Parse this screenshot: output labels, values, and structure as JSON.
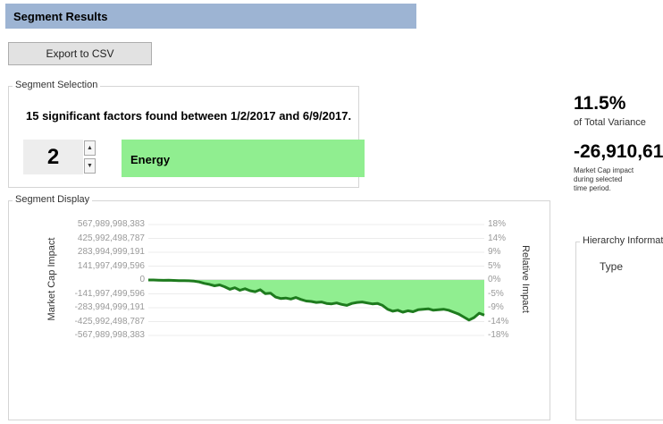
{
  "header": {
    "title": "Segment Results"
  },
  "toolbar": {
    "export_label": "Export to CSV"
  },
  "segment_selection": {
    "group_label": "Segment Selection",
    "summary": "15 significant factors found between 1/2/2017 and 6/9/2017.",
    "index_value": "2",
    "segment_name": "Energy",
    "segment_color": "#90ee90"
  },
  "stats": {
    "variance_value": "11.5%",
    "variance_label": "of Total Variance",
    "impact_value": "-26,910,61",
    "impact_desc_1": "Market Cap impact",
    "impact_desc_2": "during selected",
    "impact_desc_3": "time period."
  },
  "hierarchy": {
    "group_label": "Hierarchy Informat",
    "type_label": "Type"
  },
  "segment_display": {
    "group_label": "Segment Display"
  },
  "chart_data": {
    "type": "area",
    "ylabel": "Market Cap Impact",
    "y2label": "Relative Impact",
    "left_ticks": [
      "567,989,998,383",
      "425,992,498,787",
      "283,994,999,191",
      "141,997,499,596",
      "0",
      "-141,997,499,596",
      "-283,994,999,191",
      "-425,992,498,787",
      "-567,989,998,383"
    ],
    "right_ticks": [
      "18%",
      "14%",
      "9%",
      "5%",
      "0%",
      "-5%",
      "-9%",
      "-14%",
      "-18%"
    ],
    "ylim": [
      -567989998383,
      567989998383
    ],
    "grid": true,
    "line_color": "#1e7b1e",
    "fill_color": "#90ee90",
    "values": [
      0,
      0,
      -2000000000.0,
      -4000000000.0,
      -3000000000.0,
      -5000000000.0,
      -7000000000.0,
      -6000000000.0,
      -8000000000.0,
      -12000000000.0,
      -20000000000.0,
      -35000000000.0,
      -45000000000.0,
      -60000000000.0,
      -50000000000.0,
      -70000000000.0,
      -95000000000.0,
      -80000000000.0,
      -105000000000.0,
      -90000000000.0,
      -110000000000.0,
      -120000000000.0,
      -100000000000.0,
      -140000000000.0,
      -135000000000.0,
      -175000000000.0,
      -190000000000.0,
      -185000000000.0,
      -195000000000.0,
      -180000000000.0,
      -200000000000.0,
      -215000000000.0,
      -220000000000.0,
      -230000000000.0,
      -225000000000.0,
      -240000000000.0,
      -245000000000.0,
      -235000000000.0,
      -250000000000.0,
      -260000000000.0,
      -240000000000.0,
      -230000000000.0,
      -225000000000.0,
      -235000000000.0,
      -245000000000.0,
      -240000000000.0,
      -260000000000.0,
      -300000000000.0,
      -320000000000.0,
      -310000000000.0,
      -330000000000.0,
      -315000000000.0,
      -325000000000.0,
      -305000000000.0,
      -300000000000.0,
      -295000000000.0,
      -310000000000.0,
      -305000000000.0,
      -300000000000.0,
      -310000000000.0,
      -330000000000.0,
      -350000000000.0,
      -380000000000.0,
      -410000000000.0,
      -385000000000.0,
      -340000000000.0,
      -360000000000.0
    ]
  }
}
